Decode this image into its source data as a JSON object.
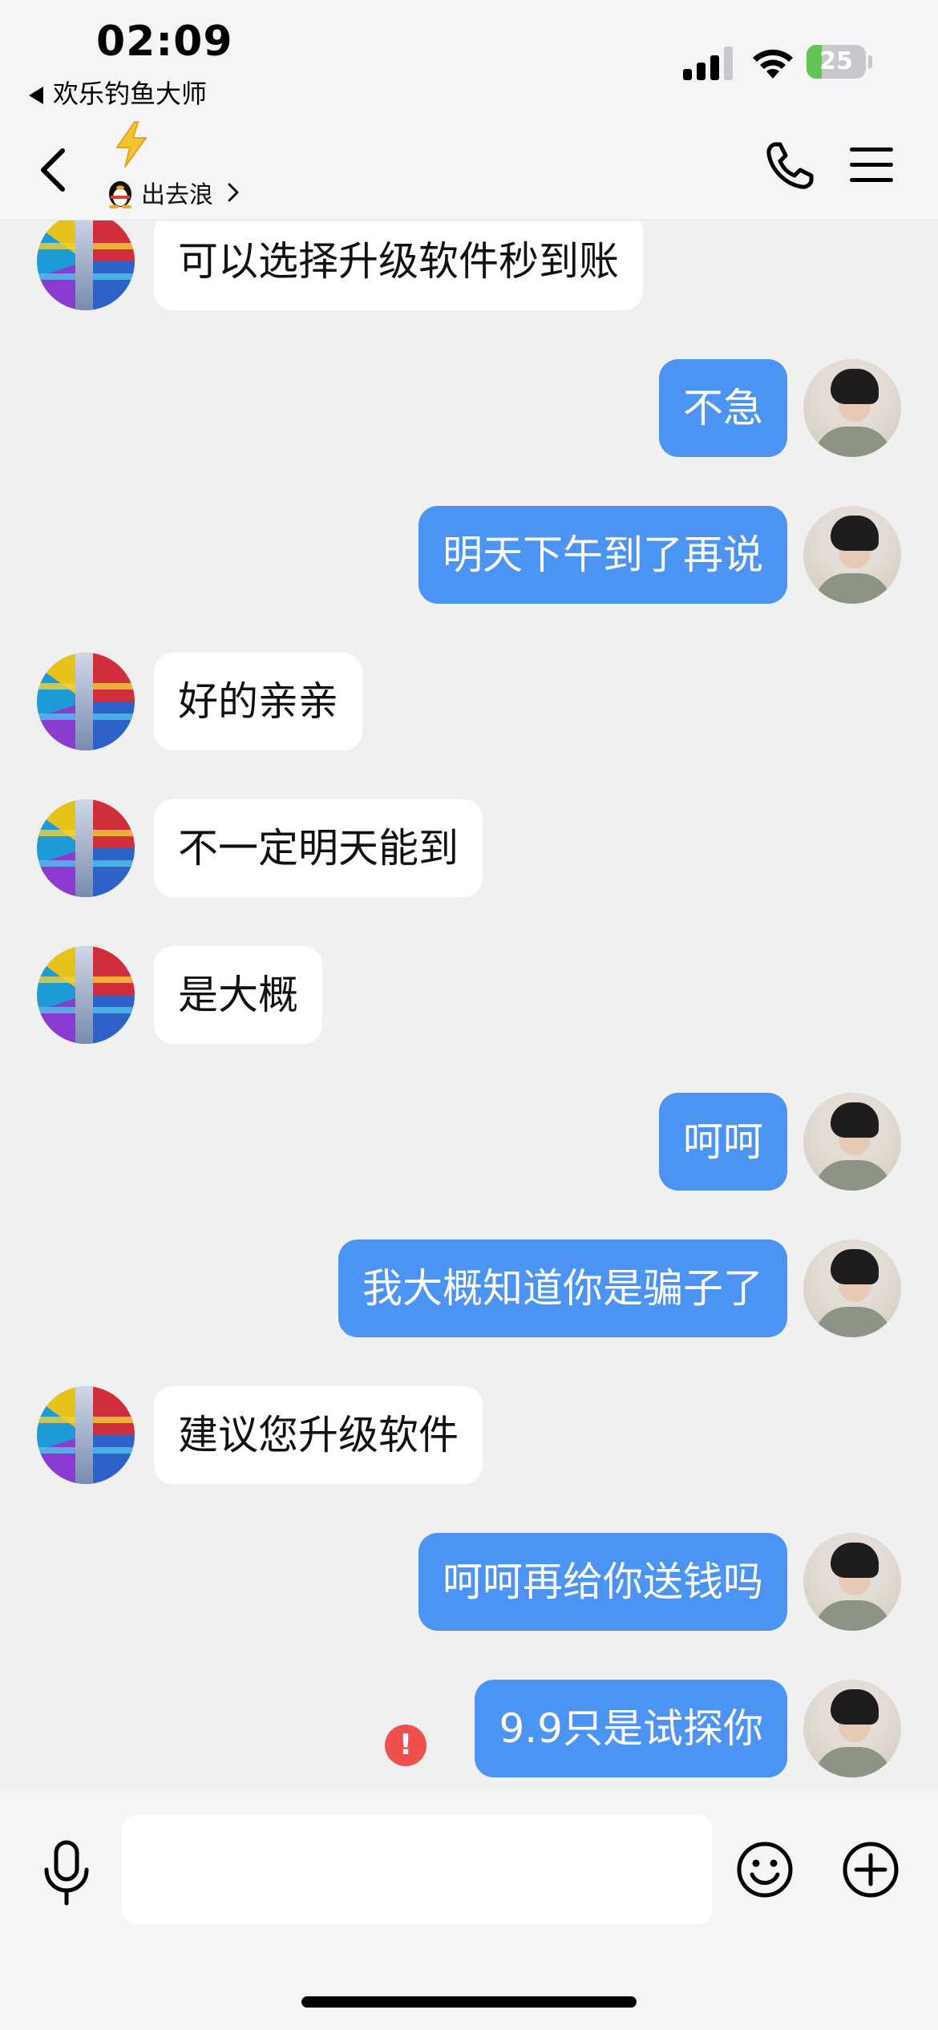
{
  "status_bar": {
    "time": "02:09",
    "back_app": "欢乐钓鱼大师",
    "battery_level": "25",
    "battery_fraction": 0.25,
    "battery_color": "#61c554",
    "icons": [
      "signal-icon",
      "wifi-icon",
      "battery-icon"
    ]
  },
  "nav": {
    "title_icon": "lightning-bolt-icon",
    "subtitle": "出去浪",
    "subtitle_icon": "qq-penguin-icon",
    "actions": [
      "phone-icon",
      "menu-icon"
    ]
  },
  "messages": [
    {
      "side": "them",
      "text": "可以选择升级软件秒到账"
    },
    {
      "side": "me",
      "text": "不急"
    },
    {
      "side": "me",
      "text": "明天下午到了再说"
    },
    {
      "side": "them",
      "text": "好的亲亲"
    },
    {
      "side": "them",
      "text": "不一定明天能到"
    },
    {
      "side": "them",
      "text": "是大概"
    },
    {
      "side": "me",
      "text": "呵呵"
    },
    {
      "side": "me",
      "text": "我大概知道你是骗子了"
    },
    {
      "side": "them",
      "text": "建议您升级软件"
    },
    {
      "side": "me",
      "text": "呵呵再给你送钱吗"
    },
    {
      "side": "me",
      "text": "9.9只是试探你",
      "failed": true,
      "failed_mark": "!"
    }
  ],
  "colors": {
    "my_bubble": "#4b94f4",
    "their_bubble": "#ffffff",
    "background": "#f0f0f0",
    "error": "#ee4f4f"
  },
  "input": {
    "placeholder": "",
    "icons": [
      "microphone-icon",
      "emoji-icon",
      "plus-icon"
    ]
  }
}
